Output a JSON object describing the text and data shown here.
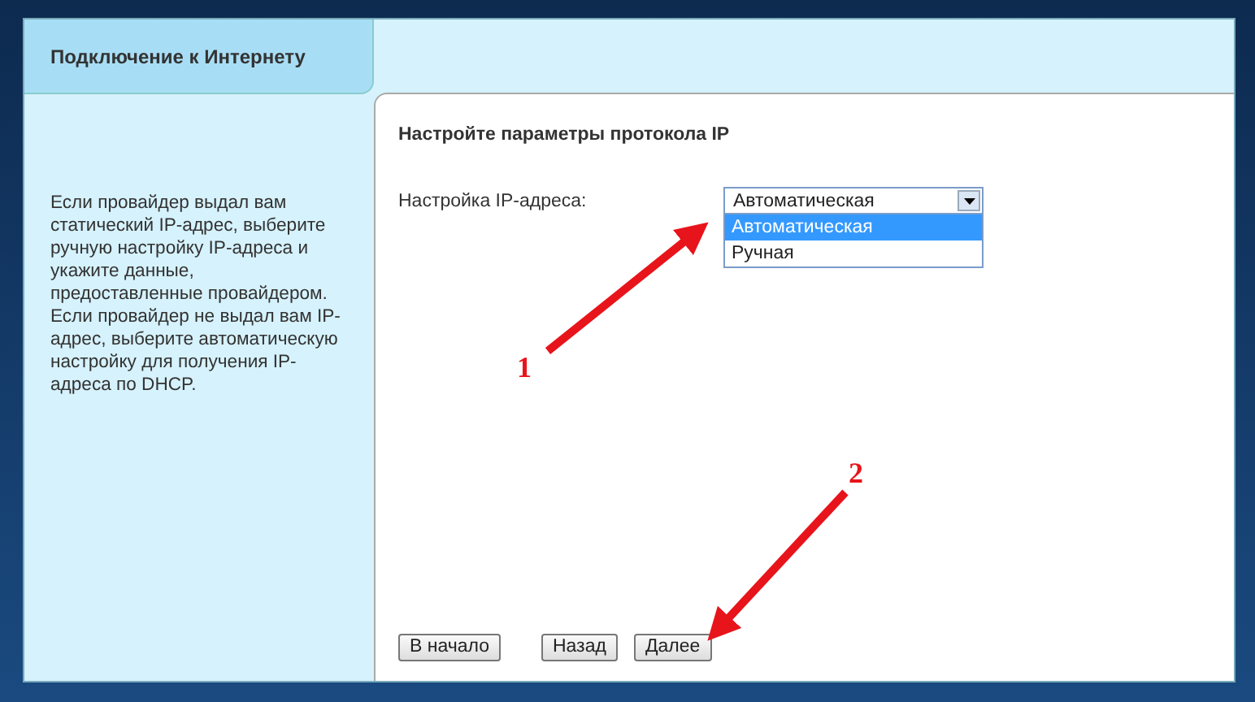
{
  "sidebar": {
    "tab": "Подключение к Интернету",
    "help_text": "Если провайдер выдал вам статический IP-адрес, выберите ручную настройку IP-адреса и укажите данные, предоставленные провайдером. Если провайдер не выдал вам IP-адрес, выберите автоматическую настройку для получения IP-адреса по DHCP."
  },
  "content": {
    "heading": "Настройте параметры протокола IP",
    "field_label": "Настройка IP-адреса:",
    "dropdown": {
      "value": "Автоматическая",
      "expanded": true,
      "options": [
        {
          "label": "Автоматическая",
          "selected": true
        },
        {
          "label": "Ручная",
          "selected": false
        }
      ]
    },
    "buttons": [
      "В начало",
      "Назад",
      "Далее"
    ]
  },
  "annotations": [
    {
      "number": "1"
    },
    {
      "number": "2"
    }
  ]
}
